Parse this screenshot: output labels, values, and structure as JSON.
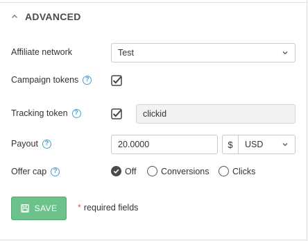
{
  "section": {
    "title": "ADVANCED"
  },
  "affiliate_network": {
    "label": "Affiliate network",
    "value": "Test"
  },
  "campaign_tokens": {
    "label": "Campaign tokens",
    "help": "?",
    "checked": true
  },
  "tracking_token": {
    "label": "Tracking token",
    "help": "?",
    "checked": true,
    "value": "clickid"
  },
  "payout": {
    "label": "Payout",
    "help": "?",
    "value": "20.0000",
    "currency_symbol": "$",
    "currency": "USD"
  },
  "offer_cap": {
    "label": "Offer cap",
    "help": "?",
    "options": [
      {
        "label": "Off",
        "checked": true
      },
      {
        "label": "Conversions",
        "checked": false
      },
      {
        "label": "Clicks",
        "checked": false
      }
    ]
  },
  "actions": {
    "save_label": "SAVE",
    "required_star": "*",
    "required_text": "required fields"
  },
  "colors": {
    "accent_blue": "#3aa3dd",
    "save_green": "#6cc28a",
    "required_red": "#e05a4f"
  }
}
